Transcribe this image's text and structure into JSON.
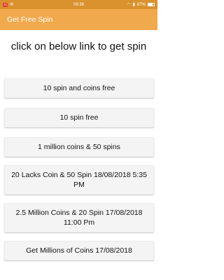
{
  "status_bar": {
    "left_badge": "20",
    "time": "09:36",
    "battery": "87%",
    "background": "#d9922e"
  },
  "app_bar": {
    "title": "Get Free Spin",
    "background": "#f0a94d"
  },
  "heading": "click on below link to get spin",
  "links": [
    {
      "label": "10 spin and coins free"
    },
    {
      "label": "10 spin free"
    },
    {
      "label": "1 million coins & 50 spins"
    },
    {
      "label": "20 Lacks Coin & 50 Spin 18/08/2018 5:35 PM"
    },
    {
      "label": "2.5 Million Coins & 20 Spin 17/08/2018 11:00 Pm"
    },
    {
      "label": "Get Millions of Coins 17/08/2018"
    }
  ]
}
